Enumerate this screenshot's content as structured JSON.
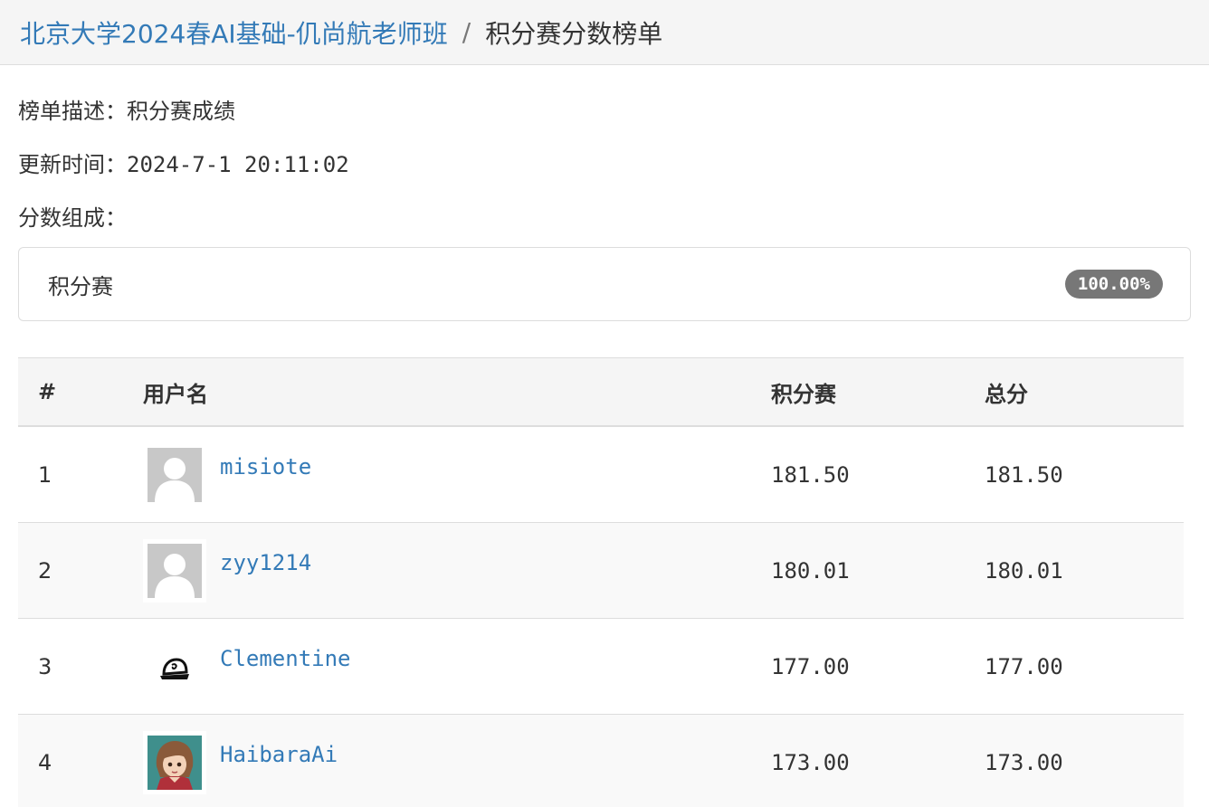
{
  "breadcrumb": {
    "course": "北京大学2024春AI基础-仉尚航老师班",
    "separator": "/",
    "current": "积分赛分数榜单"
  },
  "meta": {
    "description_label": "榜单描述：",
    "description_value": "积分赛成绩",
    "updated_label": "更新时间：",
    "updated_value": "2024-7-1 20:11:02",
    "composition_label": "分数组成："
  },
  "composition": [
    {
      "name": "积分赛",
      "percent": "100.00%"
    }
  ],
  "table": {
    "headers": {
      "rank": "#",
      "user": "用户名",
      "contest": "积分赛",
      "total": "总分"
    },
    "rows": [
      {
        "rank": "1",
        "username": "misiote",
        "avatar": "default-avatar-icon",
        "contest": "181.50",
        "total": "181.50"
      },
      {
        "rank": "2",
        "username": "zyy1214",
        "avatar": "default-avatar-icon",
        "contest": "180.01",
        "total": "180.01"
      },
      {
        "rank": "3",
        "username": "Clementine",
        "avatar": "cap-avatar-icon",
        "contest": "177.00",
        "total": "177.00"
      },
      {
        "rank": "4",
        "username": "HaibaraAi",
        "avatar": "anime-girl-avatar-icon",
        "contest": "173.00",
        "total": "173.00"
      }
    ]
  },
  "colors": {
    "link": "#337ab7",
    "badge": "#777777",
    "header_bg": "#f5f5f5",
    "stripe_bg": "#f9f9f9",
    "border": "#dddddd"
  }
}
